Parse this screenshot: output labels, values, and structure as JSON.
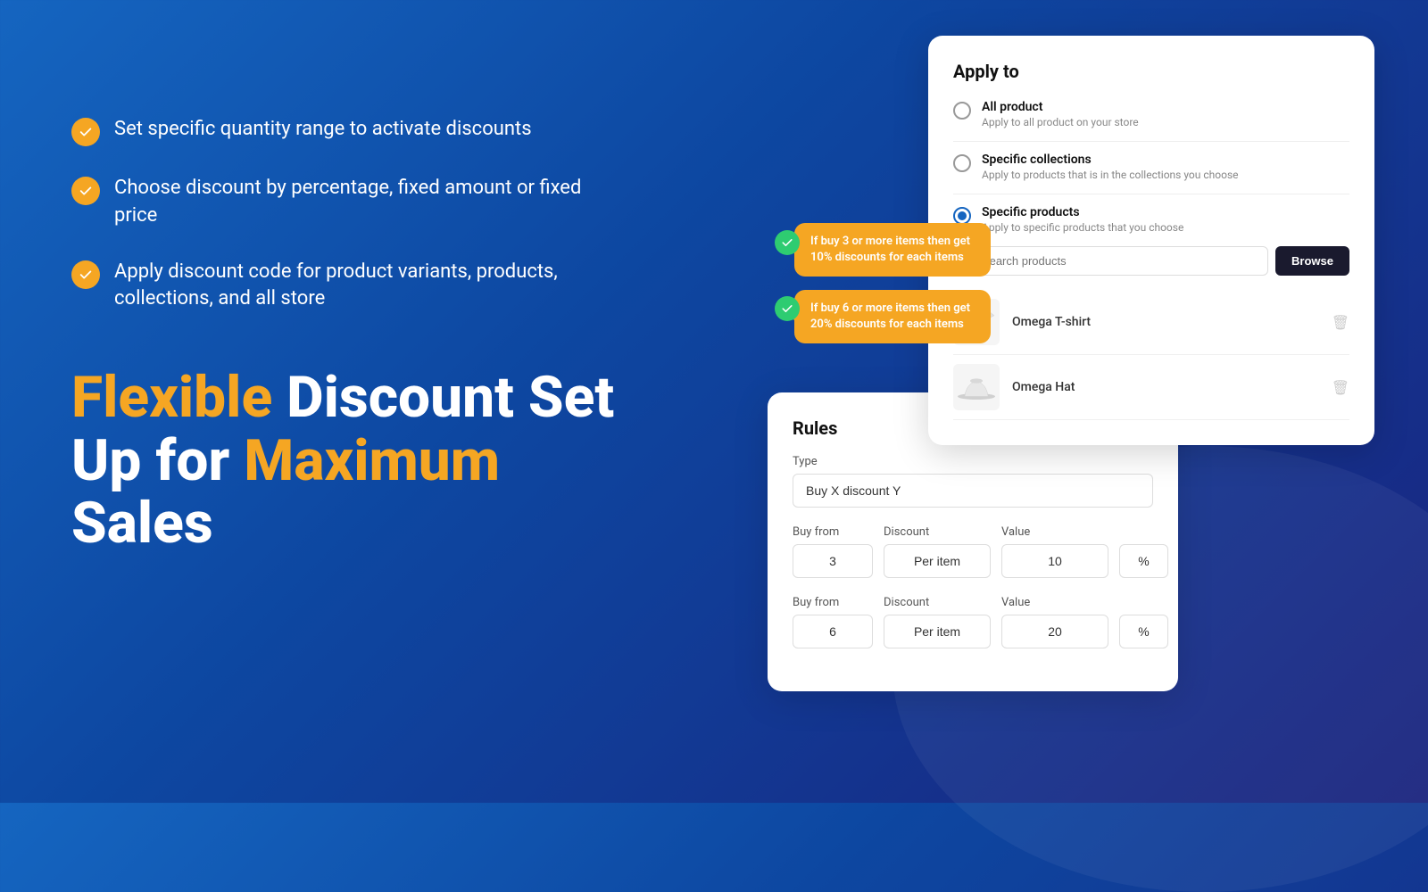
{
  "background": {
    "gradient_start": "#1565c0",
    "gradient_end": "#1a237e"
  },
  "features": {
    "items": [
      {
        "id": "feature-1",
        "text": "Set specific quantity range to activate discounts"
      },
      {
        "id": "feature-2",
        "text": "Choose discount by percentage, fixed amount or fixed price"
      },
      {
        "id": "feature-3",
        "text": "Apply discount code for product variants, products, collections, and all store"
      }
    ]
  },
  "headline": {
    "part1": "Flexible",
    "part2": " Discount Set Up for ",
    "part3": "Maximum",
    "part4": " Sales"
  },
  "apply_to_card": {
    "title": "Apply to",
    "options": [
      {
        "id": "all-product",
        "label": "All product",
        "sublabel": "Apply to all product on your store",
        "selected": false
      },
      {
        "id": "specific-collections",
        "label": "Specific collections",
        "sublabel": "Apply to products that is in the collections you choose",
        "selected": false
      },
      {
        "id": "specific-products",
        "label": "Specific products",
        "sublabel": "Apply to specific products that you choose",
        "selected": true
      }
    ],
    "search_placeholder": "search products",
    "browse_label": "Browse",
    "products": [
      {
        "name": "Omega T-shirt",
        "thumb_type": "tshirt"
      },
      {
        "name": "Omega Hat",
        "thumb_type": "hat"
      }
    ]
  },
  "tooltips": [
    {
      "id": "tooltip-1",
      "text": "If buy 3 or more items then get 10% discounts for each items"
    },
    {
      "id": "tooltip-2",
      "text": "If buy 6 or more items then get 20% discounts for each items"
    }
  ],
  "rules_card": {
    "title": "Rules",
    "type_label": "Type",
    "type_value": "Buy X discount Y",
    "rows": [
      {
        "buy_from_label": "Buy from",
        "buy_from_value": "3",
        "discount_label": "Discount",
        "discount_value": "Per item",
        "value_label": "Value",
        "value_number": "10",
        "unit": "%"
      },
      {
        "buy_from_label": "Buy from",
        "buy_from_value": "6",
        "discount_label": "Discount",
        "discount_value": "Per item",
        "value_label": "Value",
        "value_number": "20",
        "unit": "%"
      }
    ]
  }
}
